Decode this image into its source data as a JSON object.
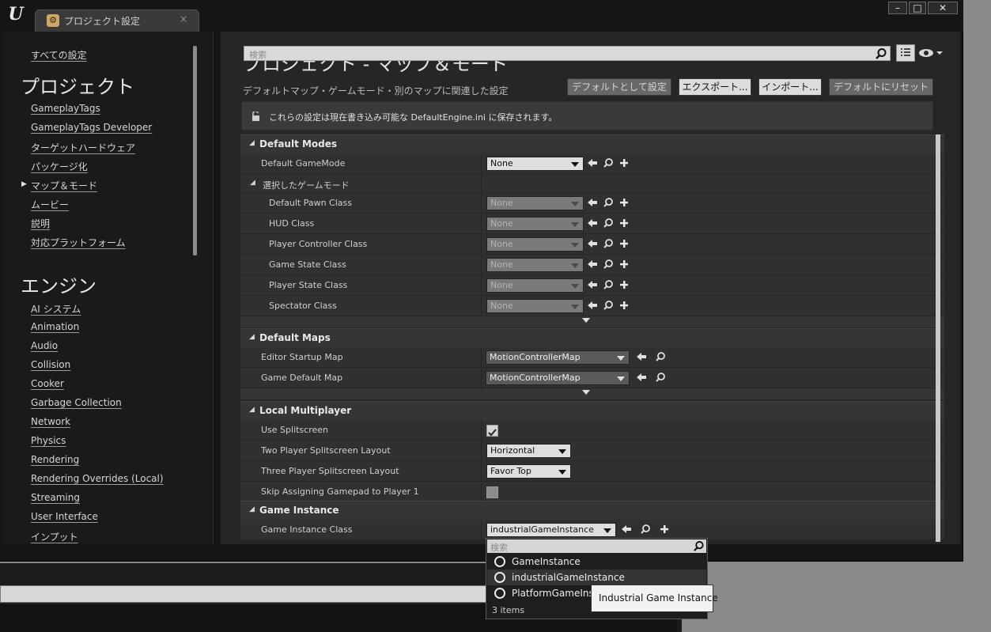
{
  "window": {
    "tab_title": "プロジェクト設定",
    "tab_close": "×",
    "logo": "U",
    "controls": {
      "minimize": "–",
      "maximize": "□",
      "close": "✕"
    }
  },
  "sidebar": {
    "all_settings": "すべての設定",
    "project_heading": "プロジェクト",
    "project_items": [
      "GameplayTags",
      "GameplayTags Developer",
      "ターゲットハードウェア",
      "パッケージ化",
      "マップ＆モード",
      "ムービー",
      "説明",
      "対応プラットフォーム"
    ],
    "selected_indicator": "▶",
    "engine_heading": "エンジン",
    "engine_items": [
      "AI システム",
      "Animation",
      "Audio",
      "Collision",
      "Cooker",
      "Garbage Collection",
      "Network",
      "Physics",
      "Rendering",
      "Rendering Overrides (Local)",
      "Streaming",
      "User Interface",
      "インプット"
    ]
  },
  "header": {
    "search_placeholder": "検索",
    "title": "プロジェクト - マップ＆モード",
    "subtitle": "デフォルトマップ・ゲームモード・別のマップに関連した設定",
    "buttons": {
      "set_default": "デフォルトとして設定",
      "export": "エクスポート...",
      "import": "インポート...",
      "reset_default": "デフォルトにリセット"
    },
    "notice": "これらの設定は現在書き込み可能な DefaultEngine.ini に保存されます。"
  },
  "sections": {
    "default_modes": {
      "title": "Default Modes",
      "default_gamemode_label": "Default GameMode",
      "default_gamemode_value": "None",
      "selected_gamemode_label": "選択したゲームモード",
      "sub_rows": [
        {
          "label": "Default Pawn Class",
          "value": "None"
        },
        {
          "label": "HUD Class",
          "value": "None"
        },
        {
          "label": "Player Controller Class",
          "value": "None"
        },
        {
          "label": "Game State Class",
          "value": "None"
        },
        {
          "label": "Player State Class",
          "value": "None"
        },
        {
          "label": "Spectator Class",
          "value": "None"
        }
      ]
    },
    "default_maps": {
      "title": "Default Maps",
      "rows": [
        {
          "label": "Editor Startup Map",
          "value": "MotionControllerMap"
        },
        {
          "label": "Game Default Map",
          "value": "MotionControllerMap"
        }
      ]
    },
    "local_multiplayer": {
      "title": "Local Multiplayer",
      "use_splitscreen_label": "Use Splitscreen",
      "use_splitscreen_checked": true,
      "two_player_label": "Two Player Splitscreen Layout",
      "two_player_value": "Horizontal",
      "three_player_label": "Three Player Splitscreen Layout",
      "three_player_value": "Favor Top",
      "skip_gamepad_label": "Skip Assigning Gamepad to Player 1",
      "skip_gamepad_checked": false
    },
    "game_instance": {
      "title": "Game Instance",
      "class_label": "Game Instance Class",
      "class_value": "industrialGameInstance"
    }
  },
  "popup": {
    "search_placeholder": "検索",
    "options": [
      "GameInstance",
      "industrialGameInstance",
      "PlatformGameInstance"
    ],
    "selected_index": 1,
    "count": "3 items",
    "tooltip": "Industrial Game Instance"
  },
  "colors": {
    "background": "#151515",
    "panel": "#262626",
    "row": "#303030",
    "section_header": "#353535"
  }
}
